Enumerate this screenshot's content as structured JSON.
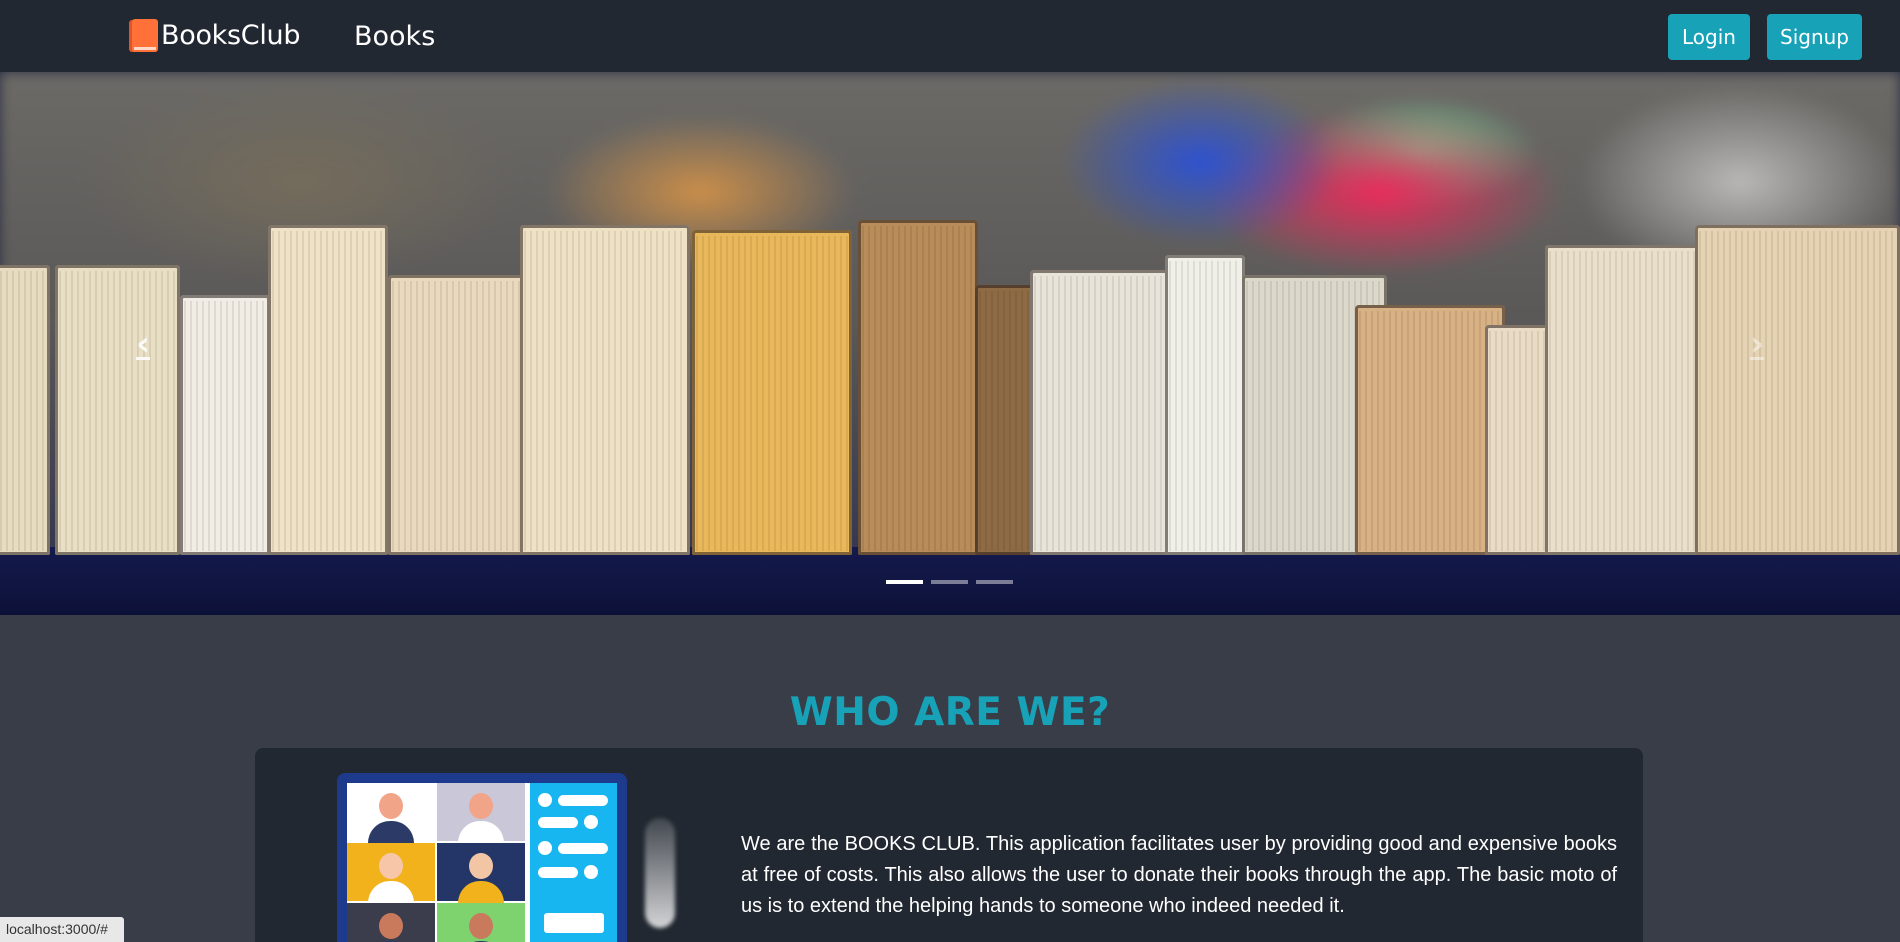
{
  "navbar": {
    "brand": "BooksClub",
    "brand_icon": "book-icon",
    "links": [
      {
        "label": "Books"
      }
    ],
    "buttons": {
      "login": "Login",
      "signup": "Signup"
    },
    "button_color": "#17a2b8",
    "background": "#222831"
  },
  "carousel": {
    "prev_icon": "chevron-left-icon",
    "next_icon": "chevron-right-icon",
    "prev_glyph": "‹",
    "next_glyph": "›",
    "slide_count": 3,
    "active_slide": 1
  },
  "about": {
    "title": "WHO ARE WE?",
    "title_color": "#17a2b8",
    "illustration": "video-call-illustration",
    "text": "We are the BOOKS CLUB. This application facilitates user by providing good and expensive books at free of costs. This also allows the user to donate their books through the app. The basic moto of us is to extend the helping hands to someone who indeed needed it."
  },
  "status_bar": {
    "url": "localhost:3000/#"
  }
}
